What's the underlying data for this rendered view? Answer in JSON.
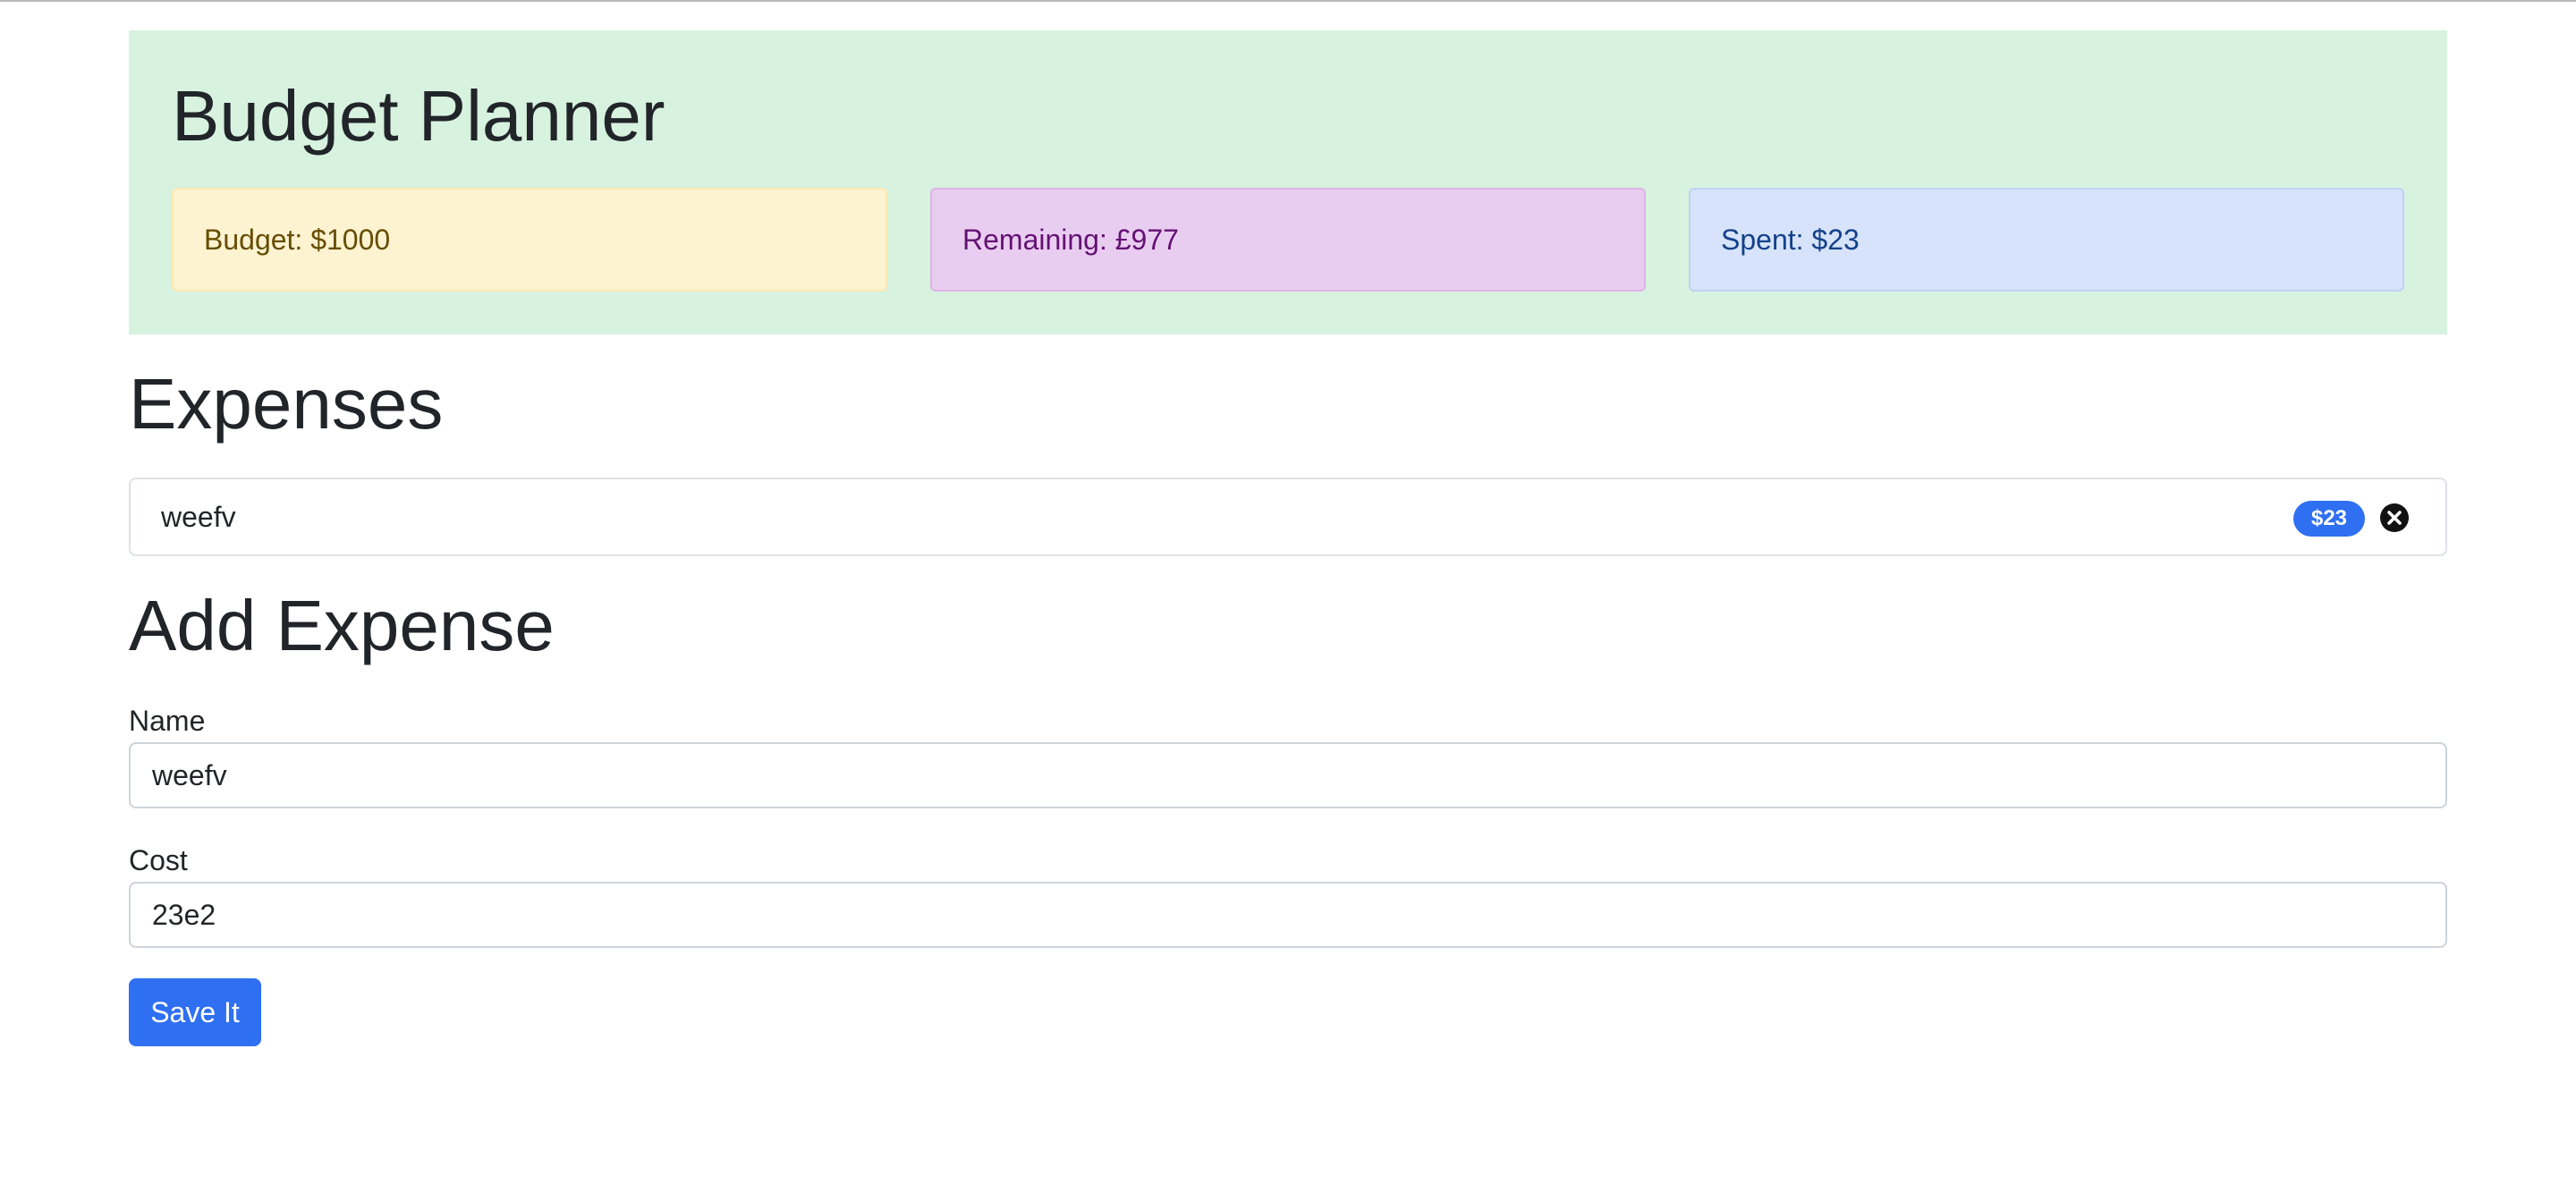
{
  "header": {
    "title": "Budget Planner",
    "budget_text": "Budget: $1000",
    "remaining_text": "Remaining: £977",
    "spent_text": "Spent: $23"
  },
  "expenses": {
    "title": "Expenses",
    "items": [
      {
        "name": "weefv",
        "cost_badge": "$23",
        "delete_icon": "close-circle-icon"
      }
    ]
  },
  "add_expense": {
    "title": "Add Expense",
    "name_label": "Name",
    "name_value": "weefv",
    "cost_label": "Cost",
    "cost_value": "23e2",
    "save_label": "Save It"
  },
  "colors": {
    "header_bg": "#d8f2e0",
    "budget_bg": "#fdf3d1",
    "remaining_bg": "#e9cdf0",
    "spent_bg": "#d6e3fa",
    "primary": "#2f6ff2"
  }
}
